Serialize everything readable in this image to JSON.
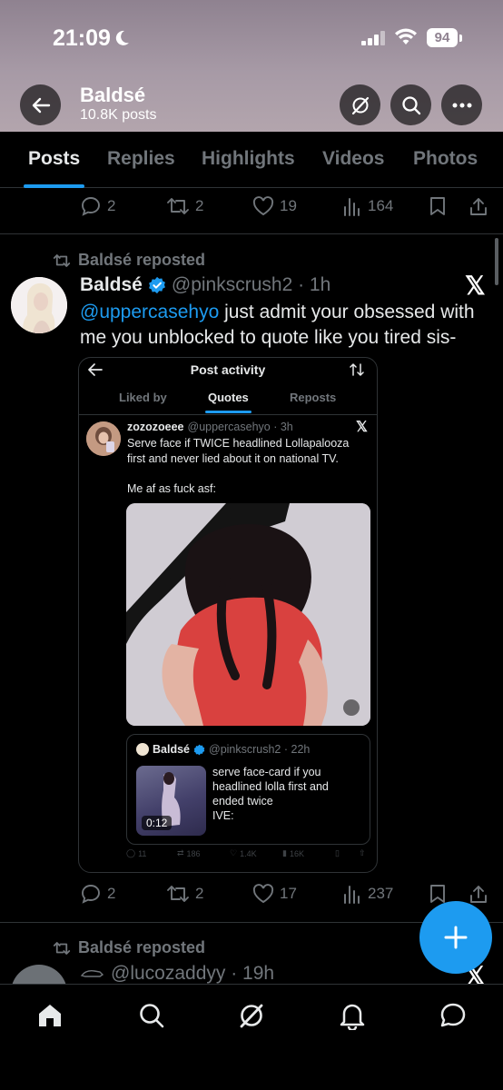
{
  "status": {
    "time": "21:09",
    "battery": "94"
  },
  "header": {
    "name": "Baldsé",
    "posts": "10.8K posts"
  },
  "tabs": [
    {
      "label": "Posts"
    },
    {
      "label": "Replies"
    },
    {
      "label": "Highlights"
    },
    {
      "label": "Videos"
    },
    {
      "label": "Photos"
    }
  ],
  "prev_post": {
    "replies": "2",
    "reposts": "2",
    "likes": "19",
    "views": "164"
  },
  "post": {
    "repost_label": "Baldsé reposted",
    "display_name": "Baldsé",
    "handle_time": "@pinkscrush2 · 1h",
    "mention": "@uppercasehyo",
    "text": " just admit your obsessed with me you unblocked to quote like you tired sis-",
    "replies": "2",
    "reposts": "2",
    "likes": "17",
    "views": "237"
  },
  "embedded": {
    "title": "Post activity",
    "tabs": [
      "Liked by",
      "Quotes",
      "Reposts"
    ],
    "user": "zozozoeee",
    "handle_time": "@uppercasehyo · 3h",
    "text": "Serve face if TWICE headlined Lollapalooza first and never lied about it on national TV.",
    "text2": "Me af as fuck asf:",
    "quote": {
      "user": "Baldsé",
      "handle_time": "@pinkscrush2 · 22h",
      "text": "serve face-card if you headlined lolla first and ended twice\nIVE:",
      "duration": "0:12"
    },
    "stats": {
      "replies": "11",
      "reposts": "186",
      "likes": "1.4K",
      "views": "16K"
    }
  },
  "next_post": {
    "repost_label": "Baldsé reposted",
    "handle_time": "@lucozaddyy · 19h"
  },
  "colors": {
    "accent": "#1d9bf0",
    "header_bg": "#a79aa6"
  }
}
